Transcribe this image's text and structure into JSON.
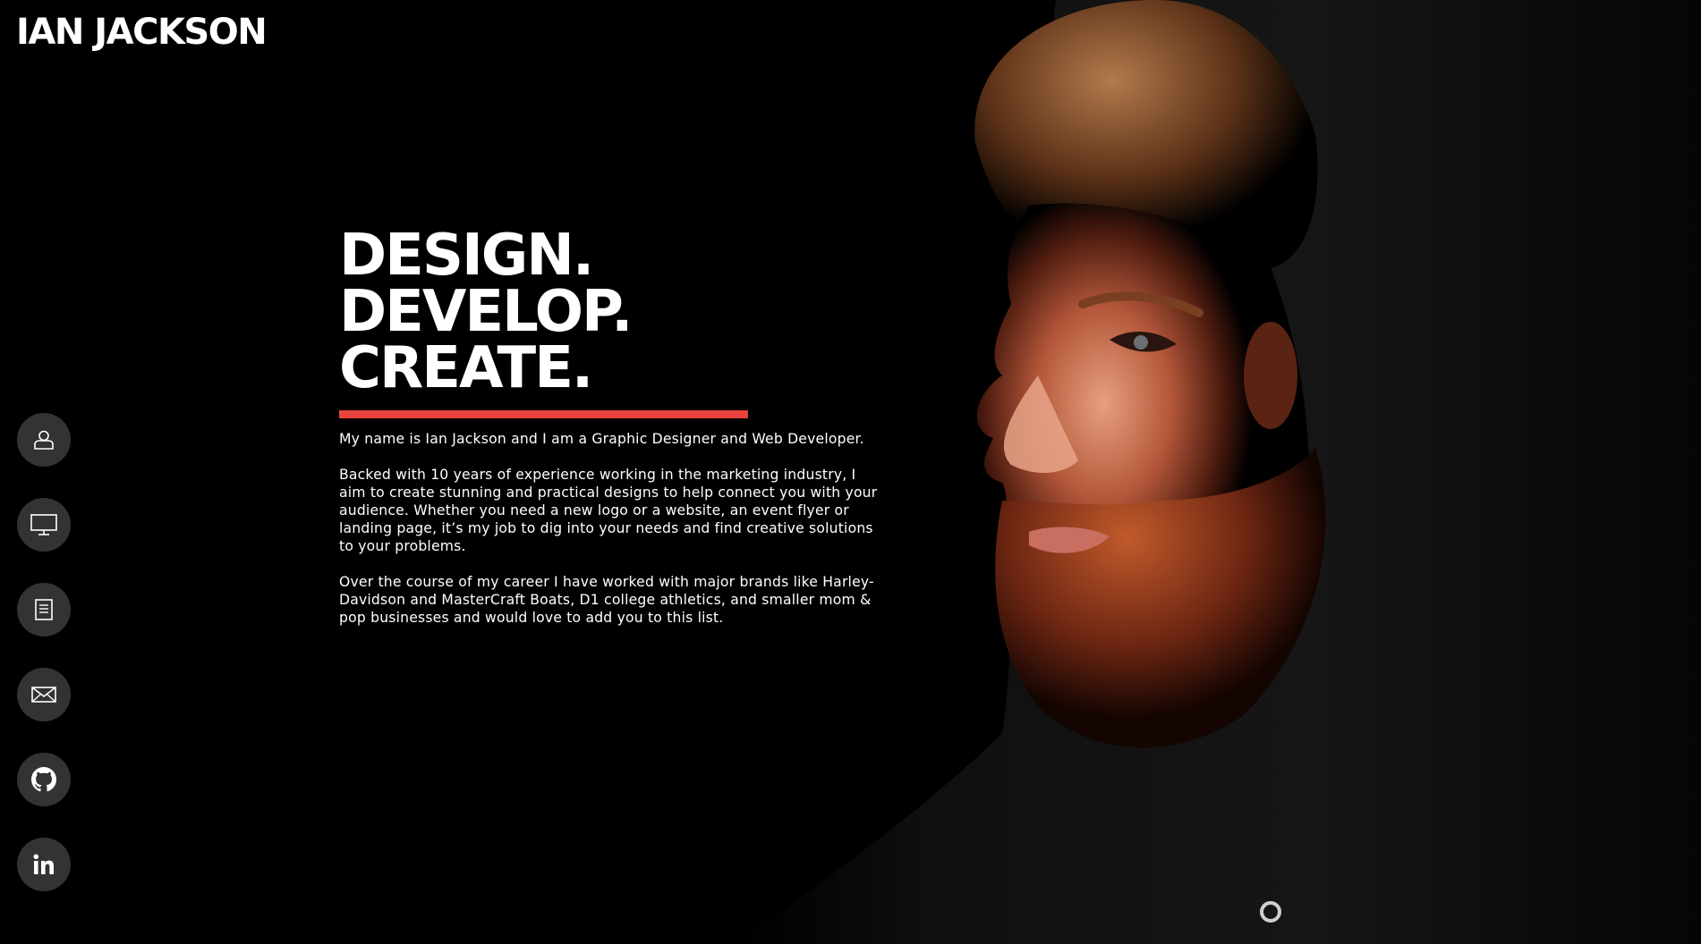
{
  "site": {
    "logo": "IAN JACKSON"
  },
  "hero": {
    "headline": [
      "DESIGN.",
      "DEVELOP.",
      "CREATE."
    ],
    "accent_color": "#e8423c",
    "paragraphs": [
      "My name is Ian Jackson and I am a Graphic Designer and Web Developer.",
      "Backed with 10 years of experience working in the marketing industry, I aim to create stunning and practical designs to help connect you with your audience. Whether you need a new logo or a website, an event flyer or landing page, it’s my job to dig into your needs and find creative solutions to your problems.",
      "Over the course of my career I have worked with major brands like Harley-Davidson and MasterCraft Boats, D1 college athletics, and smaller mom & pop businesses and would love to add you to this list."
    ]
  },
  "sidenav": {
    "items": [
      {
        "icon": "user-icon"
      },
      {
        "icon": "monitor-icon"
      },
      {
        "icon": "document-icon"
      },
      {
        "icon": "mail-icon"
      },
      {
        "icon": "github-icon"
      },
      {
        "icon": "linkedin-icon"
      }
    ]
  },
  "theme": {
    "background": "#000000",
    "text": "#ffffff",
    "nav_button": "#333333"
  }
}
